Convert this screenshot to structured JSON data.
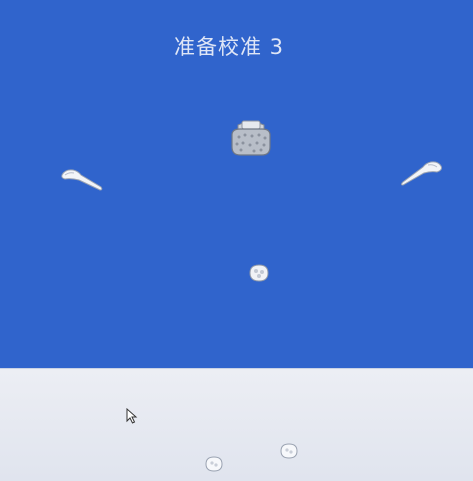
{
  "scene": {
    "title": "准备校准 3",
    "sky_color": "#3064cc",
    "floor_color": "#e6e9f1"
  },
  "objects": {
    "headset": "vr-headset-icon",
    "left_controller": "vr-controller-left-icon",
    "right_controller": "vr-controller-right-icon",
    "center_tracker": "tracker-icon",
    "floor_trackers": [
      "tracker-icon",
      "tracker-icon"
    ],
    "cursor": "mouse-cursor-icon"
  }
}
